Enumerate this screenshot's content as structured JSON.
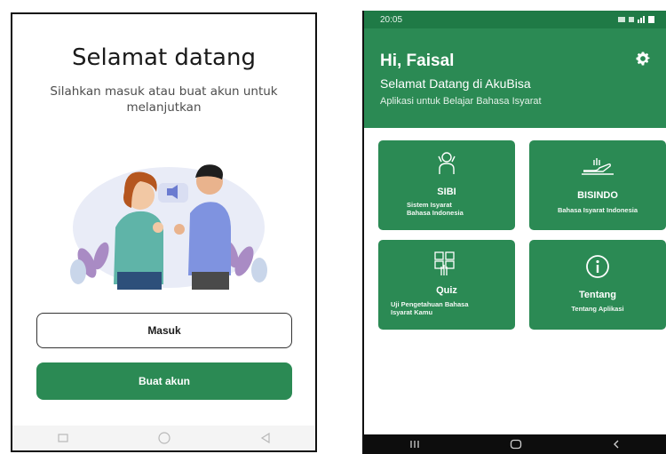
{
  "left_screen": {
    "title": "Selamat datang",
    "subtitle": "Silahkan masuk atau buat akun untuk melanjutkan",
    "login_button": "Masuk",
    "register_button": "Buat akun",
    "nav_icons": [
      "square-icon",
      "circle-icon",
      "back-triangle-icon"
    ]
  },
  "right_screen": {
    "status_time": "20:05",
    "greeting": "Hi,  Faisal",
    "header_title": "Selamat Datang di AkuBisa",
    "header_subtitle": "Aplikasi untuk Belajar Bahasa Isyarat",
    "cards": [
      {
        "title": "SIBI",
        "desc": "Sistem Isyarat\nBahasa Indonesia",
        "icon": "sibi-sign-icon"
      },
      {
        "title": "BISINDO",
        "desc": "Bahasa Isyarat Indonesia",
        "icon": "bisindo-hand-icon"
      },
      {
        "title": "Quiz",
        "desc": "Uji Pengetahuan Bahasa\nIsyarat Kamu",
        "icon": "quiz-hand-icon"
      },
      {
        "title": "Tentang",
        "desc": "Tentang Aplikasi",
        "icon": "info-icon"
      }
    ],
    "nav_icons": [
      "recents-icon",
      "home-icon",
      "back-icon"
    ]
  },
  "colors": {
    "primary_green": "#2b8a54",
    "dark_green": "#1f7a46"
  }
}
